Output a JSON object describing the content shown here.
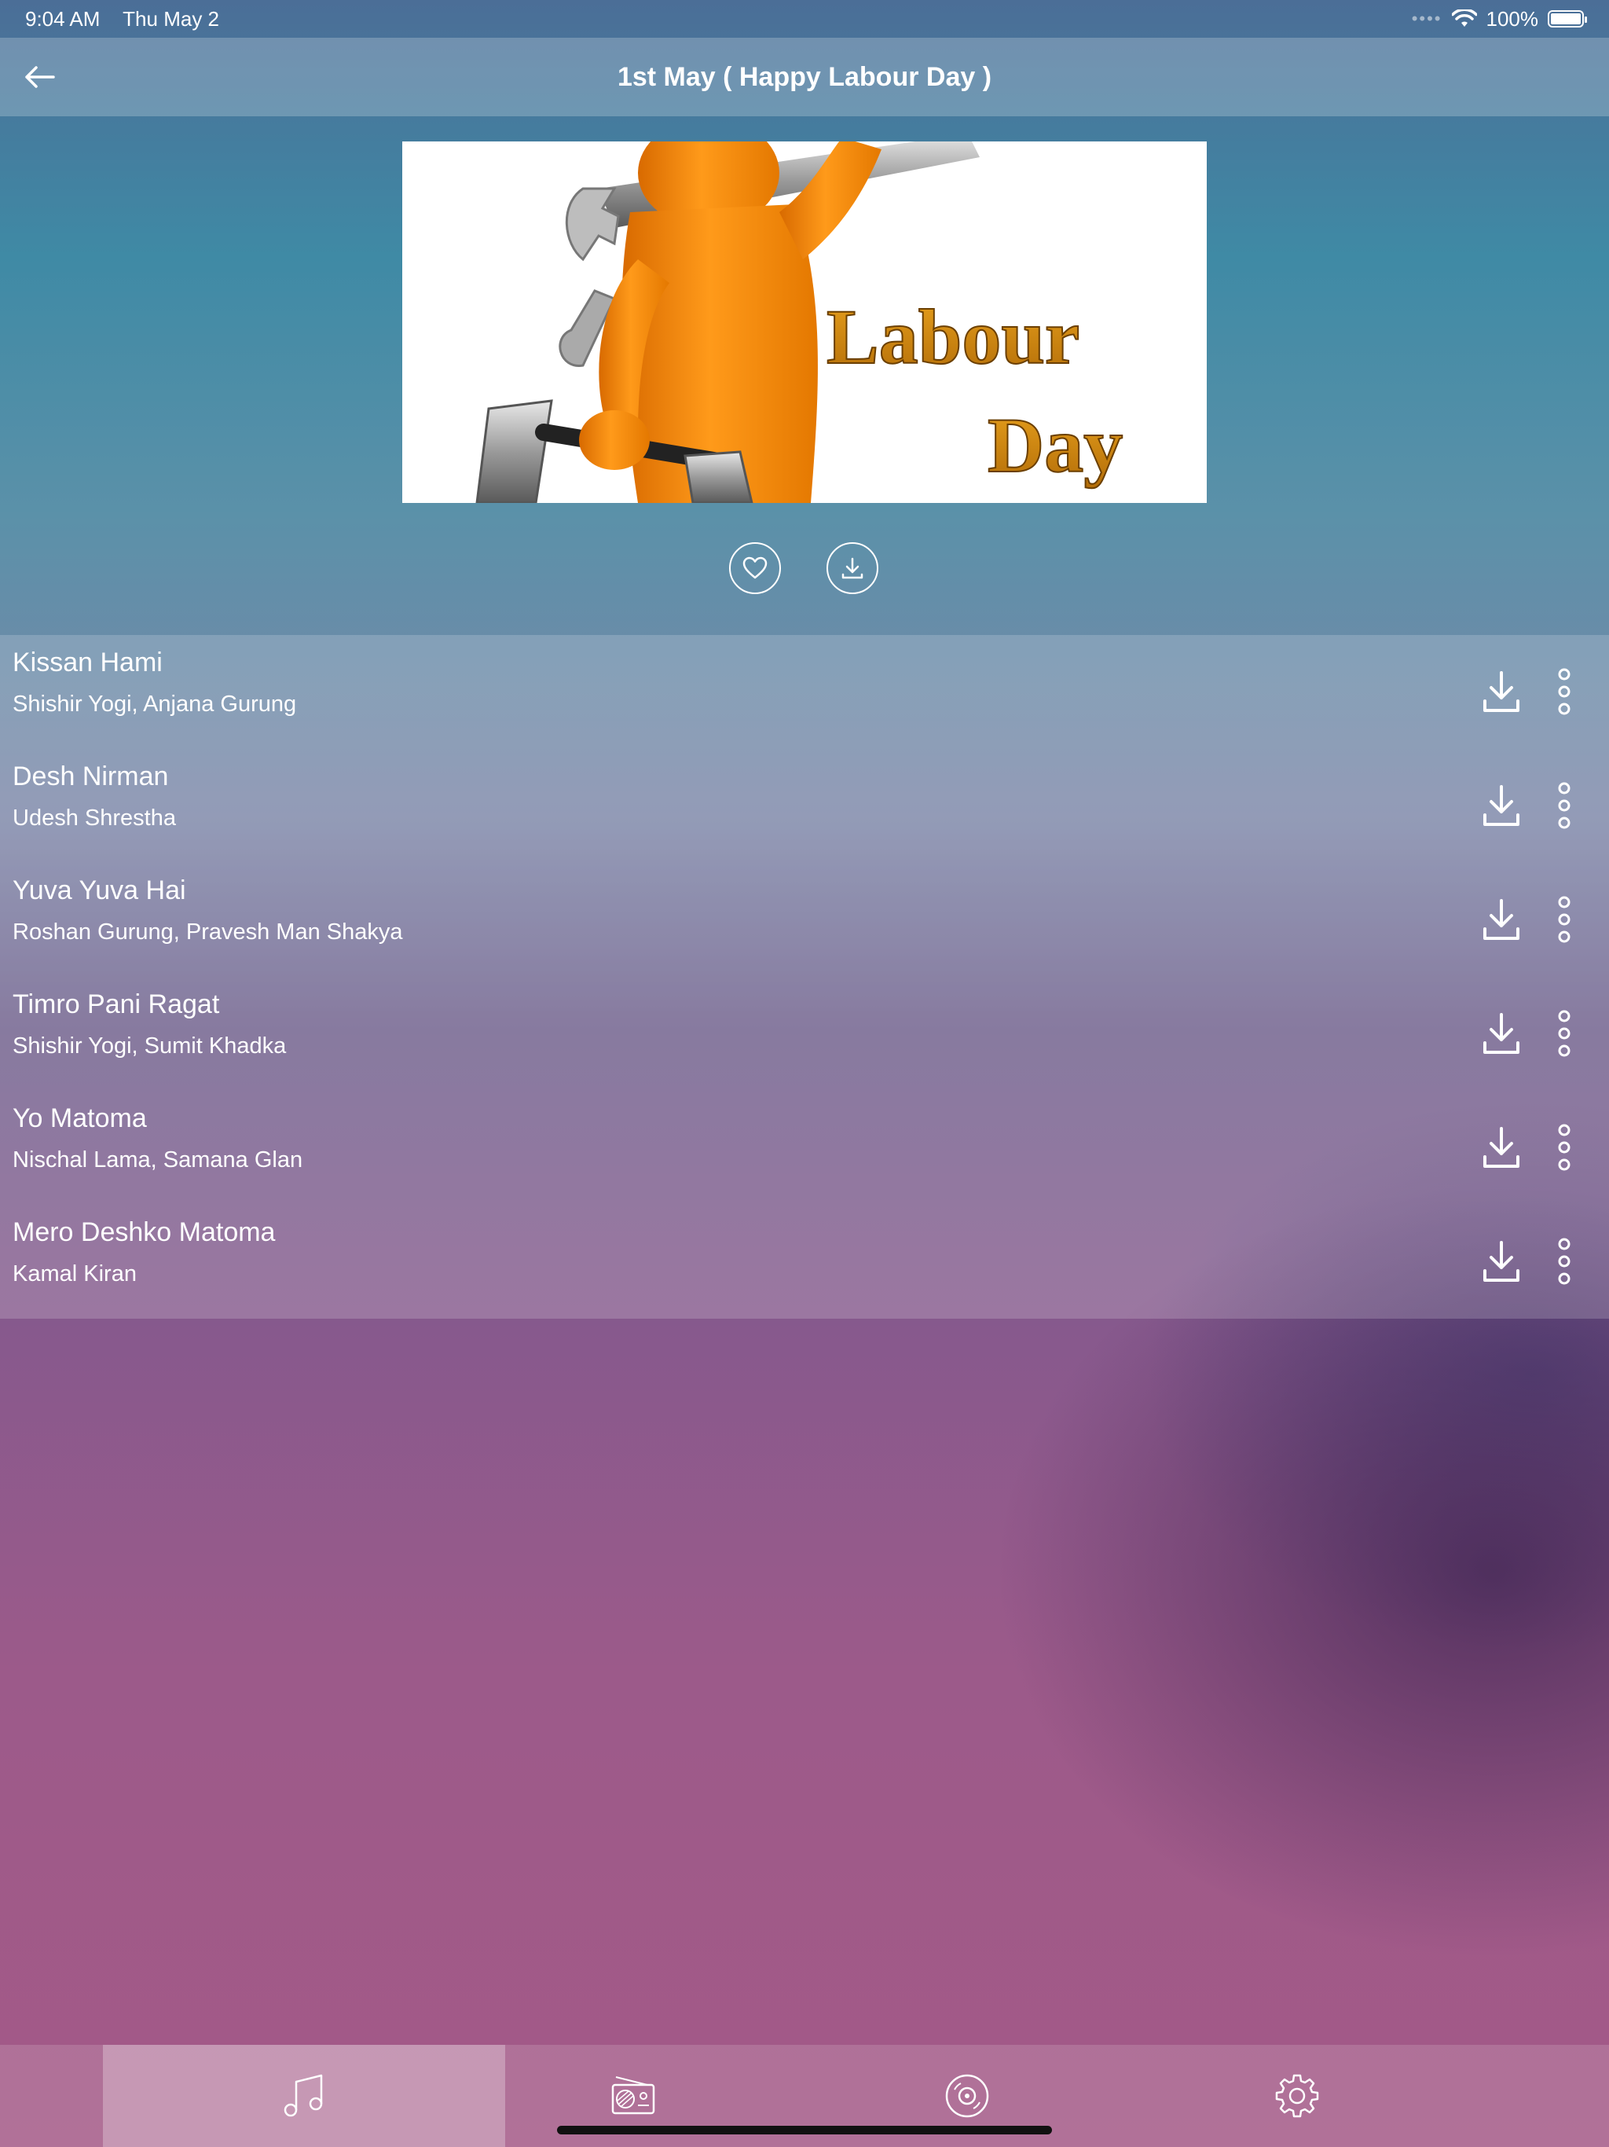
{
  "status_bar": {
    "time": "9:04 AM",
    "date": "Thu May 2",
    "battery": "100%"
  },
  "header": {
    "title": "1st May ( Happy Labour Day )",
    "back_icon": "arrow-left-icon"
  },
  "album_art": {
    "caption_line1": "Labour",
    "caption_line2": "Day"
  },
  "actions": {
    "favorite_icon": "heart-icon",
    "download_icon": "download-icon"
  },
  "tracks": [
    {
      "title": "Kissan Hami",
      "artists": "Shishir Yogi, Anjana Gurung"
    },
    {
      "title": "Desh Nirman",
      "artists": "Udesh Shrestha"
    },
    {
      "title": "Yuva Yuva Hai",
      "artists": "Roshan Gurung, Pravesh Man Shakya"
    },
    {
      "title": "Timro Pani Ragat",
      "artists": "Shishir Yogi, Sumit Khadka"
    },
    {
      "title": "Yo Matoma",
      "artists": "Nischal Lama, Samana Glan"
    },
    {
      "title": "Mero Deshko Matoma",
      "artists": "Kamal Kiran"
    }
  ],
  "tab_bar": {
    "tabs": [
      {
        "icon": "music-note-icon",
        "active": true
      },
      {
        "icon": "radio-icon",
        "active": false
      },
      {
        "icon": "disc-icon",
        "active": false
      },
      {
        "icon": "gear-icon",
        "active": false
      }
    ]
  },
  "colors": {
    "top_gradient": "#3f8aa5",
    "bottom_gradient": "#a45987",
    "accent_orange": "#f5920f"
  }
}
